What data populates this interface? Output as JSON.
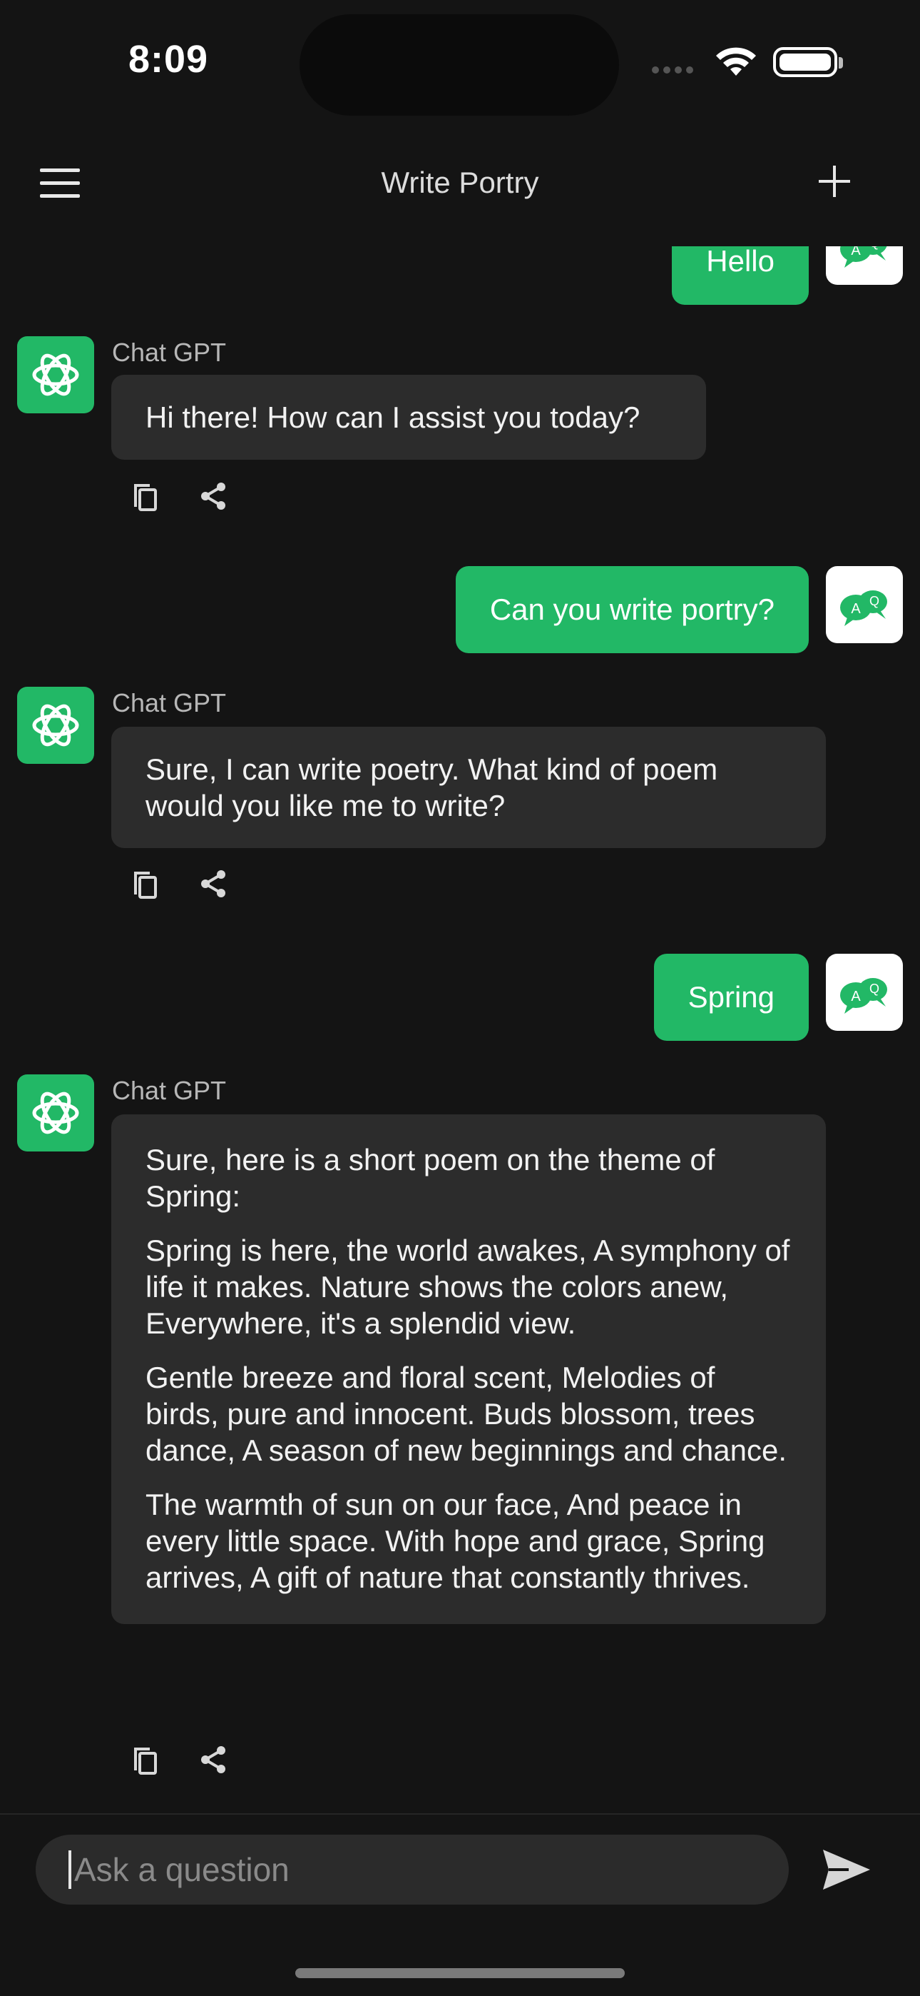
{
  "status_bar": {
    "time": "8:09"
  },
  "nav": {
    "title": "Write Portry",
    "menu_icon": "hamburger-icon",
    "new_chat_icon": "plus-icon"
  },
  "colors": {
    "accent": "#22b866",
    "background": "#141414",
    "bot_bubble": "#2c2c2c"
  },
  "messages": [
    {
      "role": "user",
      "text": "Hello"
    },
    {
      "role": "assistant",
      "sender": "Chat GPT",
      "paragraphs": [
        "Hi there! How can I assist you today?"
      ]
    },
    {
      "role": "user",
      "text": "Can you write portry?"
    },
    {
      "role": "assistant",
      "sender": "Chat GPT",
      "paragraphs": [
        "Sure, I can write poetry. What kind of poem would you like me to write?"
      ]
    },
    {
      "role": "user",
      "text": "Spring"
    },
    {
      "role": "assistant",
      "sender": "Chat GPT",
      "paragraphs": [
        "Sure, here is a short poem on the theme of Spring:",
        "Spring is here, the world awakes, A symphony of life it makes. Nature shows the colors anew, Everywhere, it's a splendid view.",
        "Gentle breeze and floral scent, Melodies of birds, pure and innocent. Buds blossom, trees dance, A season of new beginnings and chance.",
        "The warmth of sun on our face, And peace in every little space. With hope and grace, Spring arrives, A gift of nature that constantly thrives."
      ]
    }
  ],
  "user_avatar_letters": {
    "a": "A",
    "q": "Q"
  },
  "input": {
    "placeholder": "Ask a question",
    "value": ""
  }
}
